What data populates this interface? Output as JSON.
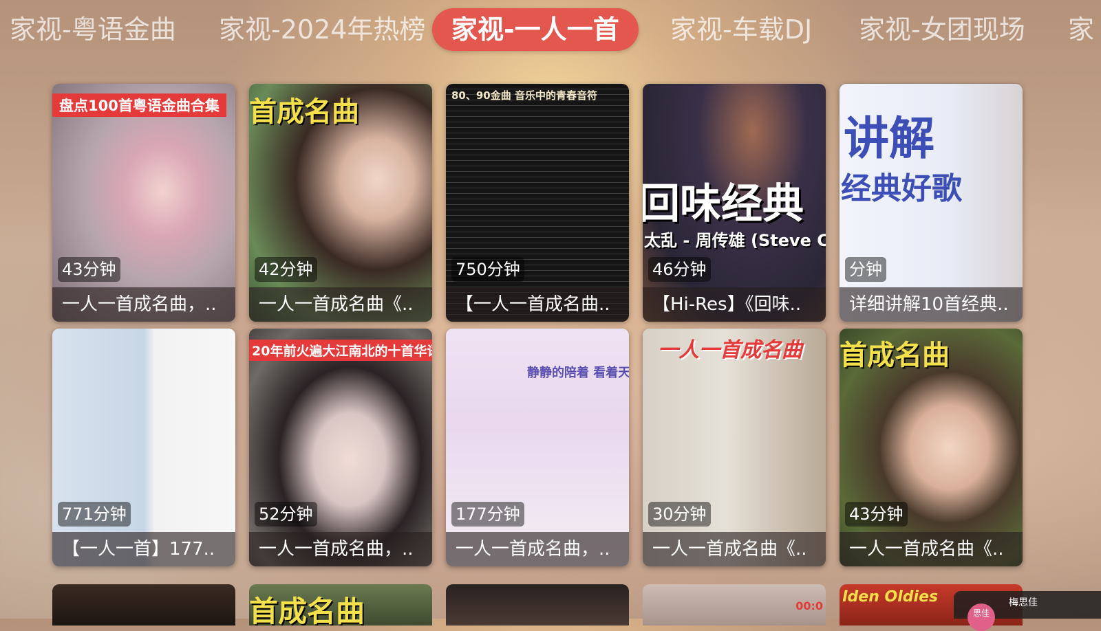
{
  "tabs": [
    {
      "label": "家视-粤语金曲",
      "active": false
    },
    {
      "label": "家视-2024年热榜",
      "active": false
    },
    {
      "label": "家视-一人一首",
      "active": true
    },
    {
      "label": "家视-车载DJ",
      "active": false
    },
    {
      "label": "家视-女团现场",
      "active": false
    },
    {
      "label": "家",
      "active": false
    }
  ],
  "cards": [
    {
      "duration": "43分钟",
      "title": "一人一首成名曲，..",
      "overlay": "盘点100首粤语金曲合集"
    },
    {
      "duration": "42分钟",
      "title": "一人一首成名曲《..",
      "overlay": "首成名曲"
    },
    {
      "duration": "750分钟",
      "title": "【一人一首成名曲..",
      "overlay": "80、90金曲 音乐中的青春音符"
    },
    {
      "duration": "46分钟",
      "title": "【Hi-Res】《回味..",
      "overlay": "回味经典",
      "overlay2": "太乱 - 周传雄 (Steve C"
    },
    {
      "duration": "分钟",
      "title": "详细讲解10首经典..",
      "overlay": "讲解",
      "overlay2": "经典好歌"
    },
    {
      "duration": "771分钟",
      "title": "【一人一首】177..",
      "overlay": ""
    },
    {
      "duration": "52分钟",
      "title": "一人一首成名曲，..",
      "overlay": "20年前火遍大江南北的十首华语"
    },
    {
      "duration": "177分钟",
      "title": "一人一首成名曲，..",
      "overlay": "静静的陪着 看着天"
    },
    {
      "duration": "30分钟",
      "title": "一人一首成名曲《..",
      "overlay": "一人一首成名曲"
    },
    {
      "duration": "43分钟",
      "title": "一人一首成名曲《..",
      "overlay": "首成名曲"
    }
  ],
  "partial_row": [
    {
      "overlay": ""
    },
    {
      "overlay": "首成名曲"
    },
    {
      "overlay": ""
    },
    {
      "overlay": "00:0"
    },
    {
      "overlay": "lden Oldies"
    }
  ],
  "user": {
    "name": "梅思佳",
    "avatar_text": "思佳"
  }
}
